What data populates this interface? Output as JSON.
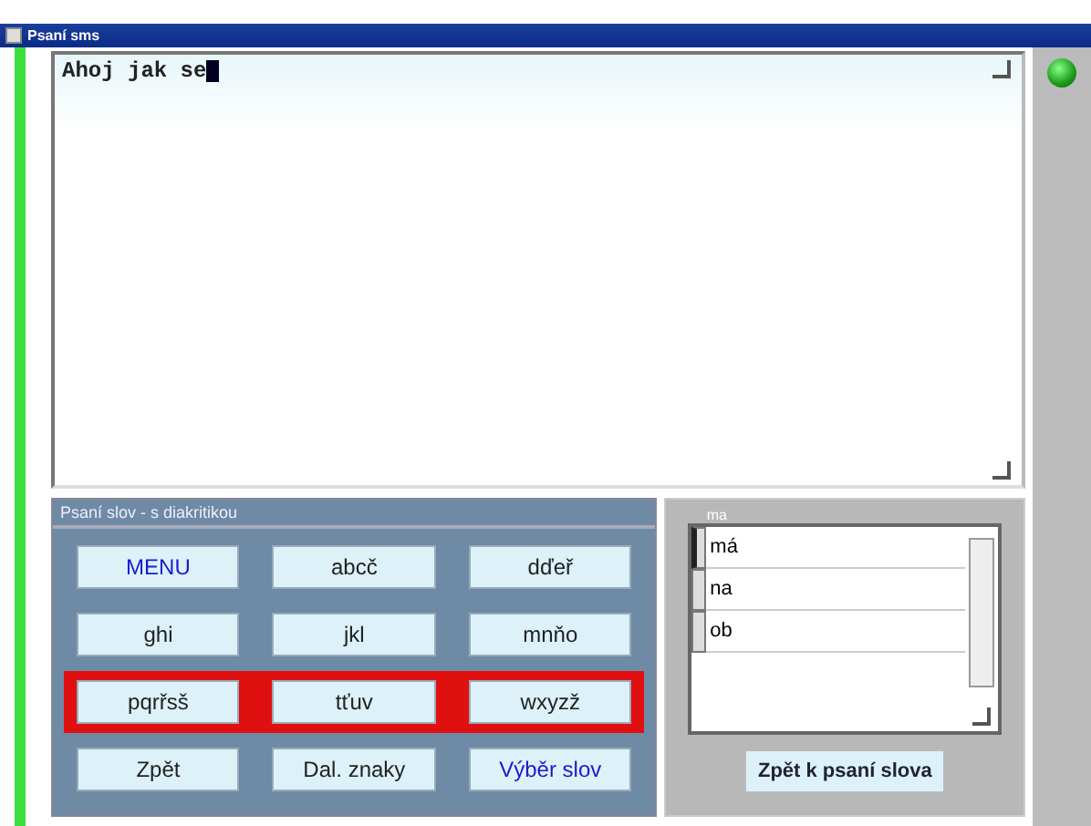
{
  "window": {
    "title": "Psaní sms"
  },
  "editor": {
    "value": "Ahoj jak se"
  },
  "status": {
    "on": true
  },
  "keyboard": {
    "title": "Psaní slov - s diakritikou",
    "rows": [
      {
        "highlighted": false,
        "keys": [
          {
            "label": "MENU",
            "kind": "command"
          },
          {
            "label": "abcč",
            "kind": "letters"
          },
          {
            "label": "dďeř",
            "kind": "letters"
          }
        ]
      },
      {
        "highlighted": false,
        "keys": [
          {
            "label": "ghi",
            "kind": "letters"
          },
          {
            "label": "jkl",
            "kind": "letters"
          },
          {
            "label": "mnňo",
            "kind": "letters"
          }
        ]
      },
      {
        "highlighted": true,
        "keys": [
          {
            "label": "pqrřsš",
            "kind": "letters"
          },
          {
            "label": "tťuv",
            "kind": "letters"
          },
          {
            "label": "wxyzž",
            "kind": "letters"
          }
        ]
      },
      {
        "highlighted": false,
        "keys": [
          {
            "label": "Zpět",
            "kind": "letters"
          },
          {
            "label": "Dal. znaky",
            "kind": "letters"
          },
          {
            "label": "Výběr slov",
            "kind": "command"
          }
        ]
      }
    ]
  },
  "words": {
    "label": "ma",
    "items": [
      {
        "text": "má",
        "selected": true
      },
      {
        "text": "na",
        "selected": false
      },
      {
        "text": "ob",
        "selected": false
      }
    ],
    "button": "Zpět k psaní slova"
  }
}
